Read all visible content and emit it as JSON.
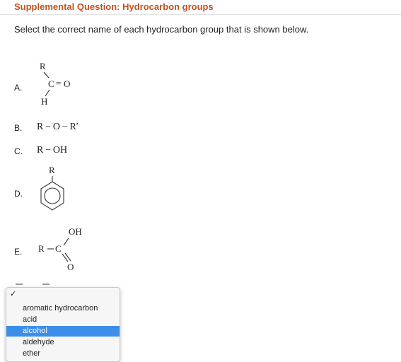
{
  "title": "Supplemental Question: Hydrocarbon groups",
  "instruction": "Select the correct name of each hydrocarbon group that is shown below.",
  "items": [
    {
      "letter": "A.",
      "atoms": {
        "r": "R",
        "c": "C",
        "o": "O",
        "h": "H",
        "eq": "="
      }
    },
    {
      "letter": "B.",
      "formula": "R − O − R′"
    },
    {
      "letter": "C.",
      "formula": "R − OH"
    },
    {
      "letter": "D.",
      "atoms": {
        "r": "R"
      }
    },
    {
      "letter": "E.",
      "atoms": {
        "r": "R",
        "c": "C",
        "oh": "OH",
        "o": "O"
      }
    }
  ],
  "dropdown": {
    "checkmark": "✓",
    "options": [
      "aromatic hydrocarbon",
      "acid",
      "alcohol",
      "aldehyde",
      "ether"
    ],
    "selected_index": 2
  },
  "colors": {
    "title": "#c0531f",
    "selection": "#3d8ee8"
  }
}
